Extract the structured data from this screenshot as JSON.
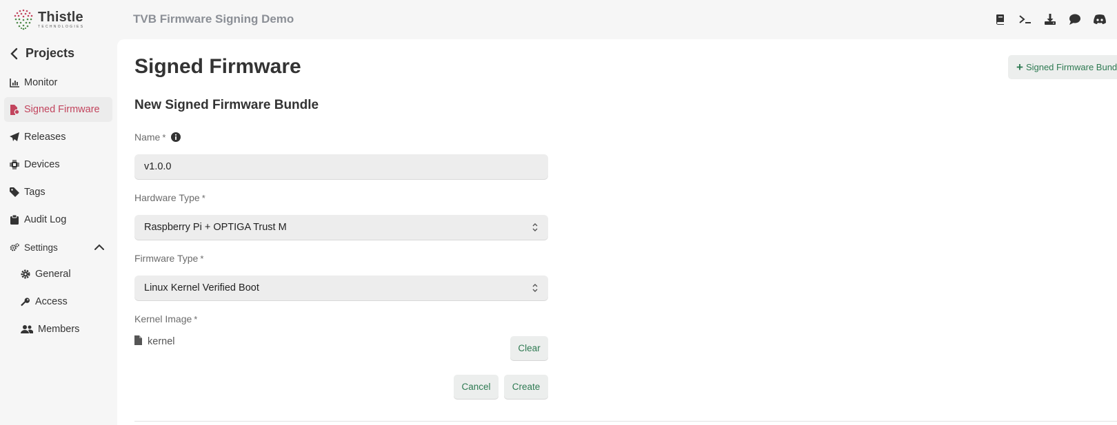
{
  "app": {
    "logo_name": "Thistle",
    "logo_sub": "TECHNOLOGIES",
    "project_title": "TVB Firmware Signing Demo"
  },
  "top_icons": [
    "book-icon",
    "terminal-icon",
    "download-icon",
    "chat-icon",
    "discord-icon"
  ],
  "sidebar": {
    "back_label": "Projects",
    "items": [
      {
        "label": "Monitor",
        "icon": "chart-icon"
      },
      {
        "label": "Signed Firmware",
        "icon": "file-signature-icon",
        "active": true
      },
      {
        "label": "Releases",
        "icon": "paper-plane-icon"
      },
      {
        "label": "Devices",
        "icon": "microchip-icon"
      },
      {
        "label": "Tags",
        "icon": "tag-icon"
      },
      {
        "label": "Audit Log",
        "icon": "clipboard-icon"
      }
    ],
    "settings": {
      "label": "Settings",
      "expanded": true,
      "children": [
        {
          "label": "General",
          "icon": "gear-icon"
        },
        {
          "label": "Access",
          "icon": "key-icon"
        },
        {
          "label": "Members",
          "icon": "users-icon"
        }
      ]
    }
  },
  "main": {
    "title": "Signed Firmware",
    "new_button_label": "Signed Firmware Bundle",
    "form": {
      "title": "New Signed Firmware Bundle",
      "name": {
        "label": "Name",
        "required_mark": "*",
        "value": "v1.0.0"
      },
      "hardware_type": {
        "label": "Hardware Type",
        "required_mark": "*",
        "value": "Raspberry Pi + OPTIGA Trust M"
      },
      "firmware_type": {
        "label": "Firmware Type",
        "required_mark": "*",
        "value": "Linux Kernel Verified Boot"
      },
      "kernel_image": {
        "label": "Kernel Image",
        "required_mark": "*",
        "file_name": "kernel",
        "clear_label": "Clear"
      },
      "cancel_label": "Cancel",
      "create_label": "Create"
    }
  },
  "colors": {
    "accent_active": "#c2445d",
    "button_text": "#2e7a52",
    "main_bg": "#ffffff",
    "shell_bg": "#f6f6f6"
  }
}
